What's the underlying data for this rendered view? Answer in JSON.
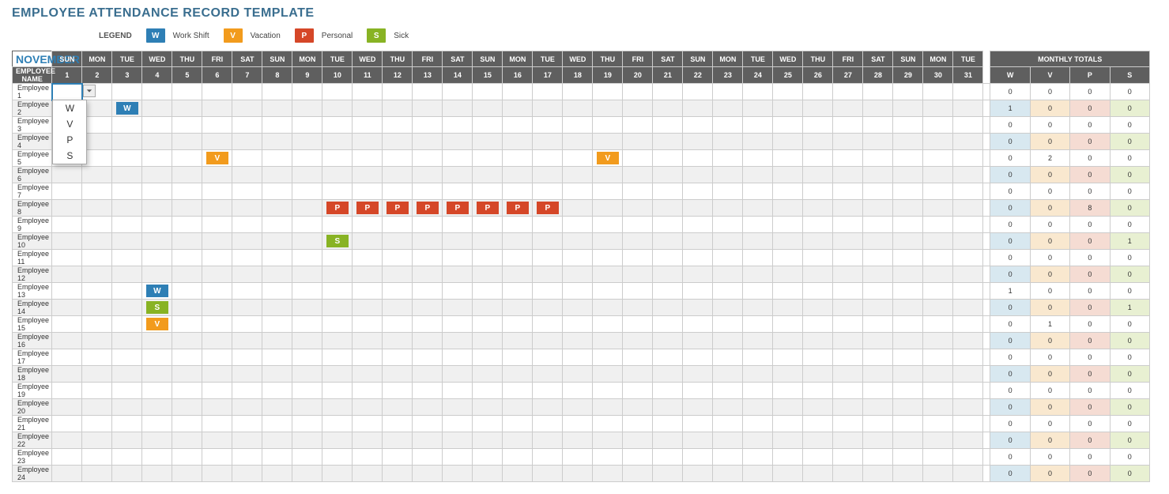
{
  "title": "EMPLOYEE ATTENDANCE RECORD TEMPLATE",
  "legend": {
    "label": "LEGEND",
    "items": [
      {
        "code": "W",
        "text": "Work Shift"
      },
      {
        "code": "V",
        "text": "Vacation"
      },
      {
        "code": "P",
        "text": "Personal"
      },
      {
        "code": "S",
        "text": "Sick"
      }
    ]
  },
  "month": "NOVEMBER",
  "employee_name_header": "EMPLOYEE NAME",
  "monthly_totals_header": "MONTHLY TOTALS",
  "days_of_week": [
    "SUN",
    "MON",
    "TUE",
    "WED",
    "THU",
    "FRI",
    "SAT",
    "SUN",
    "MON",
    "TUE",
    "WED",
    "THU",
    "FRI",
    "SAT",
    "SUN",
    "MON",
    "TUE",
    "WED",
    "THU",
    "FRI",
    "SAT",
    "SUN",
    "MON",
    "TUE",
    "WED",
    "THU",
    "FRI",
    "SAT",
    "SUN",
    "MON",
    "TUE"
  ],
  "day_numbers": [
    "1",
    "2",
    "3",
    "4",
    "5",
    "6",
    "7",
    "8",
    "9",
    "10",
    "11",
    "12",
    "13",
    "14",
    "15",
    "16",
    "17",
    "18",
    "19",
    "20",
    "21",
    "22",
    "23",
    "24",
    "25",
    "26",
    "27",
    "28",
    "29",
    "30",
    "31"
  ],
  "totals_headers": [
    "W",
    "V",
    "P",
    "S"
  ],
  "dropdown": {
    "options": [
      "W",
      "V",
      "P",
      "S"
    ],
    "active_row": 0,
    "active_col": 0
  },
  "employees": [
    {
      "name": "Employee 1",
      "marks": {},
      "totals": {
        "W": 0,
        "V": 0,
        "P": 0,
        "S": 0
      }
    },
    {
      "name": "Employee 2",
      "marks": {
        "3": "W"
      },
      "totals": {
        "W": 1,
        "V": 0,
        "P": 0,
        "S": 0
      }
    },
    {
      "name": "Employee 3",
      "marks": {},
      "totals": {
        "W": 0,
        "V": 0,
        "P": 0,
        "S": 0
      }
    },
    {
      "name": "Employee 4",
      "marks": {},
      "totals": {
        "W": 0,
        "V": 0,
        "P": 0,
        "S": 0
      }
    },
    {
      "name": "Employee 5",
      "marks": {
        "6": "V",
        "19": "V"
      },
      "totals": {
        "W": 0,
        "V": 2,
        "P": 0,
        "S": 0
      }
    },
    {
      "name": "Employee 6",
      "marks": {},
      "totals": {
        "W": 0,
        "V": 0,
        "P": 0,
        "S": 0
      }
    },
    {
      "name": "Employee 7",
      "marks": {},
      "totals": {
        "W": 0,
        "V": 0,
        "P": 0,
        "S": 0
      }
    },
    {
      "name": "Employee 8",
      "marks": {
        "10": "P",
        "11": "P",
        "12": "P",
        "13": "P",
        "14": "P",
        "15": "P",
        "16": "P",
        "17": "P"
      },
      "totals": {
        "W": 0,
        "V": 0,
        "P": 8,
        "S": 0
      }
    },
    {
      "name": "Employee 9",
      "marks": {},
      "totals": {
        "W": 0,
        "V": 0,
        "P": 0,
        "S": 0
      }
    },
    {
      "name": "Employee 10",
      "marks": {
        "10": "S"
      },
      "totals": {
        "W": 0,
        "V": 0,
        "P": 0,
        "S": 1
      }
    },
    {
      "name": "Employee 11",
      "marks": {},
      "totals": {
        "W": 0,
        "V": 0,
        "P": 0,
        "S": 0
      }
    },
    {
      "name": "Employee 12",
      "marks": {},
      "totals": {
        "W": 0,
        "V": 0,
        "P": 0,
        "S": 0
      }
    },
    {
      "name": "Employee 13",
      "marks": {
        "4": "W"
      },
      "totals": {
        "W": 1,
        "V": 0,
        "P": 0,
        "S": 0
      }
    },
    {
      "name": "Employee 14",
      "marks": {
        "4": "S"
      },
      "totals": {
        "W": 0,
        "V": 0,
        "P": 0,
        "S": 1
      }
    },
    {
      "name": "Employee 15",
      "marks": {
        "4": "V"
      },
      "totals": {
        "W": 0,
        "V": 1,
        "P": 0,
        "S": 0
      }
    },
    {
      "name": "Employee 16",
      "marks": {},
      "totals": {
        "W": 0,
        "V": 0,
        "P": 0,
        "S": 0
      }
    },
    {
      "name": "Employee 17",
      "marks": {},
      "totals": {
        "W": 0,
        "V": 0,
        "P": 0,
        "S": 0
      }
    },
    {
      "name": "Employee 18",
      "marks": {},
      "totals": {
        "W": 0,
        "V": 0,
        "P": 0,
        "S": 0
      }
    },
    {
      "name": "Employee 19",
      "marks": {},
      "totals": {
        "W": 0,
        "V": 0,
        "P": 0,
        "S": 0
      }
    },
    {
      "name": "Employee 20",
      "marks": {},
      "totals": {
        "W": 0,
        "V": 0,
        "P": 0,
        "S": 0
      }
    },
    {
      "name": "Employee 21",
      "marks": {},
      "totals": {
        "W": 0,
        "V": 0,
        "P": 0,
        "S": 0
      }
    },
    {
      "name": "Employee 22",
      "marks": {},
      "totals": {
        "W": 0,
        "V": 0,
        "P": 0,
        "S": 0
      }
    },
    {
      "name": "Employee 23",
      "marks": {},
      "totals": {
        "W": 0,
        "V": 0,
        "P": 0,
        "S": 0
      }
    },
    {
      "name": "Employee 24",
      "marks": {},
      "totals": {
        "W": 0,
        "V": 0,
        "P": 0,
        "S": 0
      }
    }
  ]
}
